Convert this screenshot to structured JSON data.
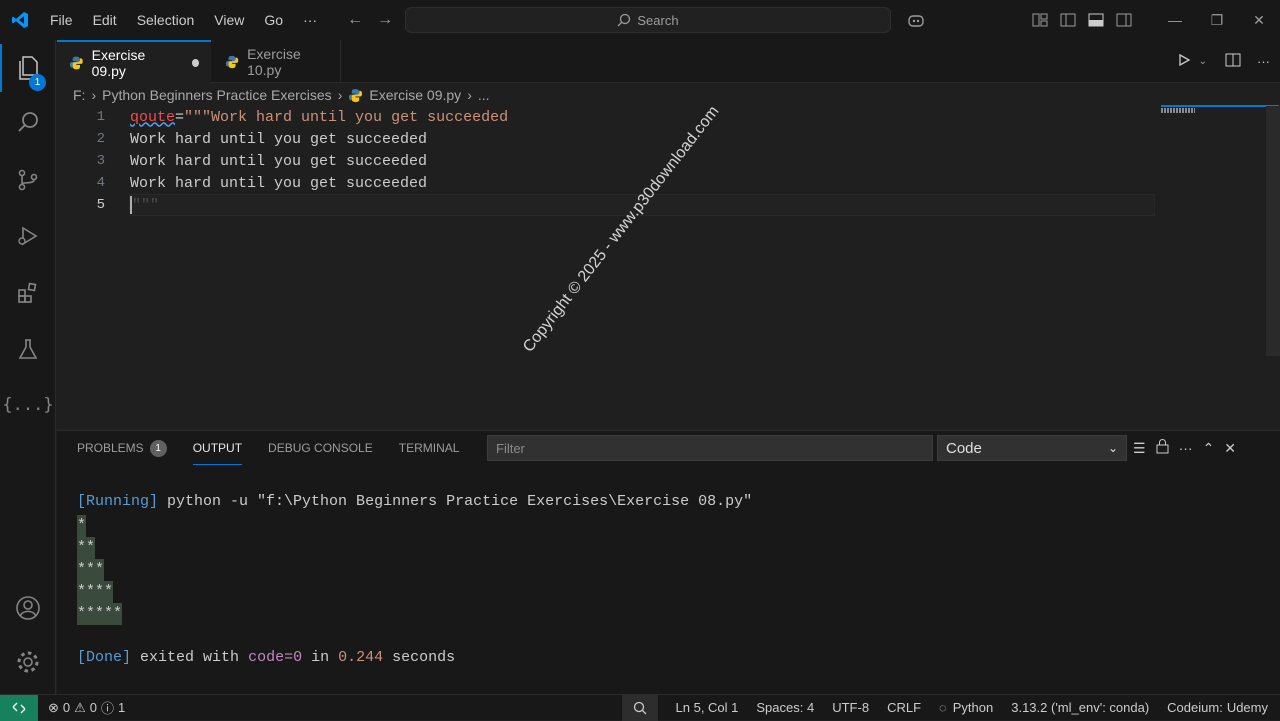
{
  "titlebar": {
    "menu": [
      "File",
      "Edit",
      "Selection",
      "View",
      "Go",
      "···"
    ],
    "search_placeholder": "Search"
  },
  "activity": {
    "explorer_badge": "1"
  },
  "tabs": [
    {
      "label": "Exercise 09.py"
    },
    {
      "label": "Exercise 10.py"
    }
  ],
  "breadcrumb": {
    "drive": "F:",
    "folder": "Python Beginners Practice Exercises",
    "file": "Exercise 09.py",
    "more": "..."
  },
  "editor": {
    "lines": [
      {
        "num": "1",
        "var": "qoute",
        "op": "=",
        "str": "\"\"\"Work hard until you get succeeded"
      },
      {
        "num": "2",
        "text": "Work hard until you get succeeded"
      },
      {
        "num": "3",
        "text": "Work hard until you get succeeded"
      },
      {
        "num": "4",
        "text": "Work hard until you get succeeded"
      },
      {
        "num": "5",
        "str": "\"\"\""
      }
    ]
  },
  "watermark": "Copyright © 2025 - www.p30download.com",
  "panel": {
    "tabs": [
      "PROBLEMS",
      "OUTPUT",
      "DEBUG CONSOLE",
      "TERMINAL"
    ],
    "problems_badge": "1",
    "filter_placeholder": "Filter",
    "channel": "Code",
    "output": {
      "running_tag": "[Running]",
      "running_cmd": "python -u \"f:\\Python Beginners Practice Exercises\\Exercise 08.py\"",
      "stars": [
        "*",
        "**",
        "***",
        "****",
        "*****"
      ],
      "done_tag": "[Done]",
      "done_a": "exited with",
      "done_code": "code=0",
      "done_b": "in",
      "done_time": "0.244",
      "done_c": "seconds"
    }
  },
  "status": {
    "errors": "0",
    "warnings": "0",
    "info": "1",
    "position": "Ln 5, Col 1",
    "spaces": "Spaces: 4",
    "encoding": "UTF-8",
    "eol": "CRLF",
    "language": "Python",
    "interpreter": "3.13.2 ('ml_env': conda)",
    "codeium": "Codeium:",
    "udemy": "Udemy"
  }
}
